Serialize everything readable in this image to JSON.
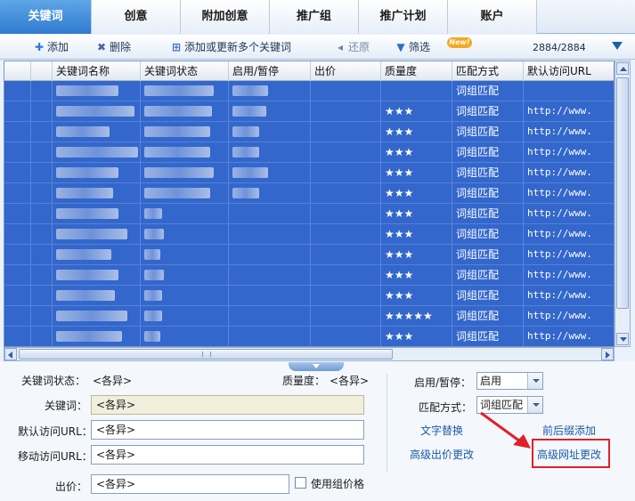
{
  "tabs": [
    {
      "label": "关键词",
      "active": true
    },
    {
      "label": "创意",
      "active": false
    },
    {
      "label": "附加创意",
      "active": false
    },
    {
      "label": "推广组",
      "active": false
    },
    {
      "label": "推广计划",
      "active": false
    },
    {
      "label": "账户",
      "active": false
    }
  ],
  "toolbar": {
    "add": "添加",
    "delete": "删除",
    "add_update_many": "添加或更新多个关键词",
    "restore": "还原",
    "filter": "筛选",
    "new_badge": "New!",
    "count": "2884/2884"
  },
  "grid": {
    "columns": [
      "关键词名称",
      "关键词状态",
      "启用/暂停",
      "出价",
      "质量度",
      "匹配方式",
      "默认访问URL"
    ],
    "rows": [
      {
        "quality": "",
        "match": "词组匹配",
        "url": ""
      },
      {
        "quality": "★★★",
        "match": "词组匹配",
        "url": "http://www."
      },
      {
        "quality": "★★★",
        "match": "词组匹配",
        "url": "http://www."
      },
      {
        "quality": "★★★",
        "match": "词组匹配",
        "url": "http://www."
      },
      {
        "quality": "★★★",
        "match": "词组匹配",
        "url": "http://www."
      },
      {
        "quality": "★★★",
        "match": "词组匹配",
        "url": "http://www."
      },
      {
        "quality": "★★★",
        "match": "词组匹配",
        "url": "http://www."
      },
      {
        "quality": "★★★",
        "match": "词组匹配",
        "url": "http://www."
      },
      {
        "quality": "★★★",
        "match": "词组匹配",
        "url": "http://www."
      },
      {
        "quality": "★★★",
        "match": "词组匹配",
        "url": "http://www."
      },
      {
        "quality": "★★★",
        "match": "词组匹配",
        "url": "http://www."
      },
      {
        "quality": "★★★★★",
        "match": "词组匹配",
        "url": "http://www."
      },
      {
        "quality": "★★★",
        "match": "词组匹配",
        "url": "http://www."
      }
    ]
  },
  "panel": {
    "status_label": "关键词状态：",
    "status_value": "<各异>",
    "quality_label": "质量度：",
    "quality_value": "<各异>",
    "keyword_label": "关键词：",
    "keyword_value": "<各异>",
    "default_url_label": "默认访问URL：",
    "default_url_value": "<各异>",
    "mobile_url_label": "移动访问URL：",
    "mobile_url_value": "<各异>",
    "bid_label": "出价：",
    "bid_value": "<各异>",
    "use_group_price": "使用组价格",
    "enable_label": "启用/暂停：",
    "enable_value": "启用",
    "match_label": "匹配方式：",
    "match_value": "词组匹配",
    "text_replace": "文字替换",
    "prefix_suffix_add": "前后缀添加",
    "advanced_bid_change": "高级出价更改",
    "advanced_url_change": "高级网址更改"
  },
  "colors": {
    "tab_active": "#2f7bd0",
    "row_selected": "#3367cc",
    "link": "#1a5aa8",
    "highlight": "#e0202a"
  }
}
